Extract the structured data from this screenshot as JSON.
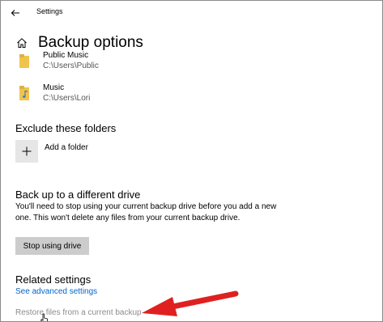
{
  "window": {
    "title": "Settings",
    "back_icon": "back-arrow-icon"
  },
  "header": {
    "home_icon": "home-icon",
    "title": "Backup options"
  },
  "folders": [
    {
      "name": "Public Music",
      "path": "C:\\Users\\Public",
      "icon": "folder-icon"
    },
    {
      "name": "Music",
      "path": "C:\\Users\\Lori",
      "icon": "music-folder-icon"
    }
  ],
  "exclude": {
    "heading": "Exclude these folders",
    "add_label": "Add a folder",
    "add_icon": "plus-icon"
  },
  "different_drive": {
    "heading": "Back up to a different drive",
    "description": "You'll need to stop using your current backup drive before you add a new one. This won't delete any files from your current backup drive.",
    "button_label": "Stop using drive"
  },
  "related": {
    "heading": "Related settings",
    "advanced_link": "See advanced settings",
    "restore_link": "Restore files from a current backup"
  },
  "colors": {
    "link": "#0066cc",
    "annotation_arrow": "#e02020",
    "button_bg": "#cccccc",
    "folder_yellow": "#f0c44c"
  }
}
